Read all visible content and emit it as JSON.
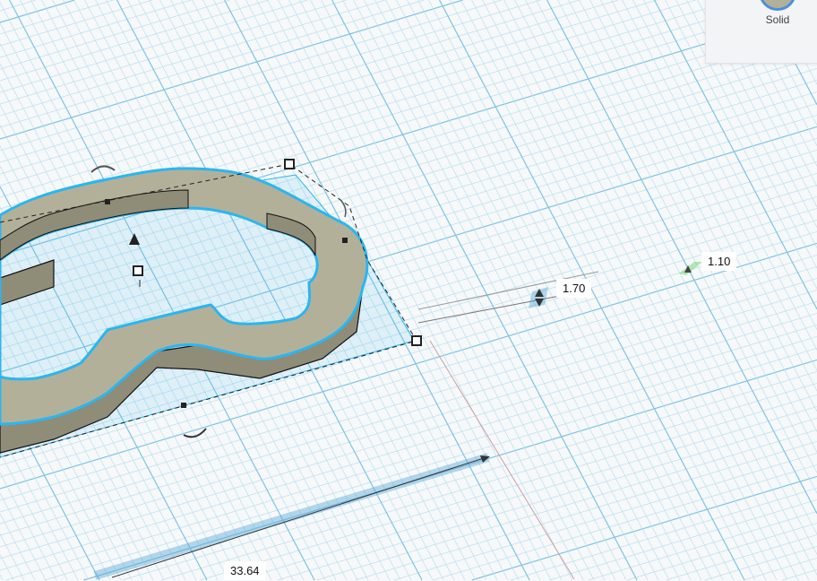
{
  "inspector": {
    "solid_label": "Solid"
  },
  "dimensions": {
    "height": "1.70",
    "elevation": "1.10",
    "length": "33.64"
  },
  "colors": {
    "shape": "#b3b09a",
    "shape_side": "#8f8c78",
    "selection": "#2ab6f0",
    "grid_minor": "#b9e0f0",
    "grid_major": "#7cc4e4"
  },
  "icons": {
    "rotate": "rotate-arrow-icon",
    "height_handle": "cone-handle-icon",
    "resize": "square-handle-icon"
  }
}
